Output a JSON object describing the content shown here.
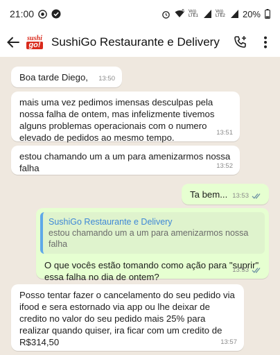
{
  "status_bar": {
    "time": "21:00",
    "net1": "Vo)) LTE1",
    "net2": "Vo)) LTE2",
    "signal_sub": "6",
    "battery": "20%"
  },
  "header": {
    "title": "SushiGo Restaurante e Delivery",
    "avatar_line1": "sushi",
    "avatar_line2": "go!"
  },
  "messages": [
    {
      "text": "Boa tarde Diego,",
      "time": "13:50"
    },
    {
      "text": "mais uma vez pedimos imensas desculpas pela nossa falha de ontem, mas infelizmente tivemos alguns problemas operacionais com o numero elevado de pedidos ao mesmo tempo.",
      "time": "13:51"
    },
    {
      "text": "estou chamando um a um para amenizarmos nossa falha",
      "time": "13:52"
    },
    {
      "text": "Ta bem...",
      "time": "13:53"
    },
    {
      "quote_author": "SushiGo Restaurante e Delivery",
      "quote_text": "estou chamando um a um para amenizarmos nossa falha",
      "text": "O que vocês estão tomando como ação para \"suprir\" essa falha no dia de ontem?",
      "time": "13:53"
    },
    {
      "text": "Posso tentar fazer o cancelamento do seu pedido via ifood e sera estornado via app ou lhe deixar de credito no valor do seu pedido mais 25% para realizar quando quiser, ira ficar com um credito de R$314,50",
      "time": "13:57"
    }
  ],
  "colors": {
    "outgoing_bubble": "#e6ffd1",
    "incoming_bubble": "#ffffff",
    "quote_accent": "#5fa8e8",
    "read_ticks": "#6b8fa3"
  }
}
